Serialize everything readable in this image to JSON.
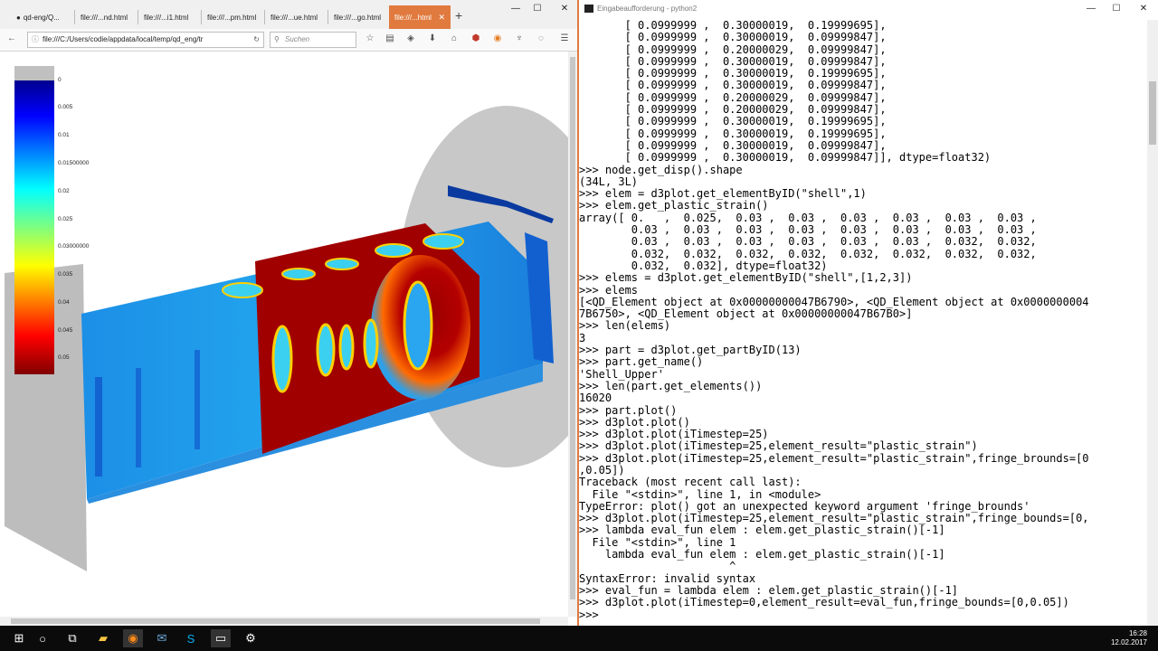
{
  "browser": {
    "tabs": [
      {
        "label": "qd-eng/Q...",
        "active": false,
        "icon": "github-icon"
      },
      {
        "label": "file:///...nd.html",
        "active": false
      },
      {
        "label": "file:///...i1.html",
        "active": false
      },
      {
        "label": "file:///...pm.html",
        "active": false
      },
      {
        "label": "file:///...ue.html",
        "active": false
      },
      {
        "label": "file:///...go.html",
        "active": false
      },
      {
        "label": "file:///...html",
        "active": true
      }
    ],
    "url": "file:///C:/Users/codie/appdata/local/temp/qd_eng/tr",
    "search_placeholder": "Suchen",
    "accent_color": "#e07a3e"
  },
  "viewer": {
    "colorbar_labels": [
      "0",
      "0.005",
      "0.01",
      "0.01500000",
      "0.02",
      "0.025",
      "0.03000000",
      "0.035",
      "0.04",
      "0.045",
      "0.05"
    ],
    "colormap": "jet-reversed"
  },
  "console": {
    "title": "Eingabeaufforderung - python2",
    "lines": [
      "       [ 0.0999999 ,  0.30000019,  0.19999695],",
      "       [ 0.0999999 ,  0.30000019,  0.09999847],",
      "       [ 0.0999999 ,  0.20000029,  0.09999847],",
      "       [ 0.0999999 ,  0.30000019,  0.09999847],",
      "       [ 0.0999999 ,  0.30000019,  0.19999695],",
      "       [ 0.0999999 ,  0.30000019,  0.09999847],",
      "       [ 0.0999999 ,  0.20000029,  0.09999847],",
      "       [ 0.0999999 ,  0.20000029,  0.09999847],",
      "       [ 0.0999999 ,  0.30000019,  0.19999695],",
      "       [ 0.0999999 ,  0.30000019,  0.19999695],",
      "       [ 0.0999999 ,  0.30000019,  0.09999847],",
      "       [ 0.0999999 ,  0.30000019,  0.09999847]], dtype=float32)",
      ">>> node.get_disp().shape",
      "(34L, 3L)",
      ">>> elem = d3plot.get_elementByID(\"shell\",1)",
      ">>> elem.get_plastic_strain()",
      "array([ 0.   ,  0.025,  0.03 ,  0.03 ,  0.03 ,  0.03 ,  0.03 ,  0.03 ,",
      "        0.03 ,  0.03 ,  0.03 ,  0.03 ,  0.03 ,  0.03 ,  0.03 ,  0.03 ,",
      "        0.03 ,  0.03 ,  0.03 ,  0.03 ,  0.03 ,  0.03 ,  0.032,  0.032,",
      "        0.032,  0.032,  0.032,  0.032,  0.032,  0.032,  0.032,  0.032,",
      "        0.032,  0.032], dtype=float32)",
      ">>> elems = d3plot.get_elementByID(\"shell\",[1,2,3])",
      ">>> elems",
      "[<QD_Element object at 0x00000000047B6790>, <QD_Element object at 0x0000000004",
      "7B6750>, <QD_Element object at 0x00000000047B67B0>]",
      ">>> len(elems)",
      "3",
      ">>> part = d3plot.get_partByID(13)",
      ">>> part.get_name()",
      "'Shell_Upper'",
      ">>> len(part.get_elements())",
      "16020",
      ">>> part.plot()",
      ">>> d3plot.plot()",
      ">>> d3plot.plot(iTimestep=25)",
      ">>> d3plot.plot(iTimestep=25,element_result=\"plastic_strain\")",
      ">>> d3plot.plot(iTimestep=25,element_result=\"plastic_strain\",fringe_brounds=[0",
      ",0.05])",
      "Traceback (most recent call last):",
      "  File \"<stdin>\", line 1, in <module>",
      "TypeError: plot() got an unexpected keyword argument 'fringe_brounds'",
      ">>> d3plot.plot(iTimestep=25,element_result=\"plastic_strain\",fringe_bounds=[0,",
      ">>> lambda eval_fun elem : elem.get_plastic_strain()[-1]",
      "  File \"<stdin>\", line 1",
      "    lambda eval_fun elem : elem.get_plastic_strain()[-1]",
      "                       ^",
      "SyntaxError: invalid syntax",
      ">>> eval_fun = lambda elem : elem.get_plastic_strain()[-1]",
      ">>> d3plot.plot(iTimestep=0,element_result=eval_fun,fringe_bounds=[0,0.05])",
      ">>>"
    ]
  },
  "taskbar": {
    "time": "16:28",
    "date": "12.02.2017",
    "icons": [
      "windows-start-icon",
      "search-icon",
      "task-view-icon",
      "file-explorer-icon",
      "firefox-icon",
      "thunderbird-icon",
      "skype-icon",
      "cmd-icon",
      "settings-icon"
    ]
  }
}
